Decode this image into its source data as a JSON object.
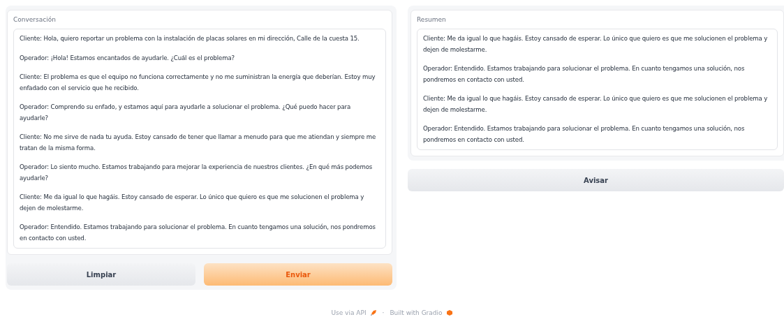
{
  "conversation": {
    "label": "Conversación",
    "messages": [
      "Cliente: Hola, quiero reportar un problema con la instalación de placas solares en mi dirección, Calle de la cuesta 15.",
      "Operador: ¡Hola! Estamos encantados de ayudarle. ¿Cuál es el problema?",
      "Cliente: El problema es que el equipo no funciona correctamente y no me suministran la energía que deberían. Estoy muy enfadado con el servicio que he recibido.",
      "Operador: Comprendo su enfado, y estamos aquí para ayudarle a solucionar el problema. ¿Qué puedo hacer para ayudarle?",
      "Cliente: No me sirve de nada tu ayuda. Estoy cansado de tener que llamar a menudo para que me atiendan y siempre me tratan de la misma forma.",
      "Operador: Lo siento mucho. Estamos trabajando para mejorar la experiencia de nuestros clientes. ¿En qué más podemos ayudarle?",
      "Cliente: Me da igual lo que hagáis. Estoy cansado de esperar. Lo único que quiero es que me solucionen el problema y dejen de molestarme.",
      "Operador: Entendido. Estamos trabajando para solucionar el problema. En cuanto tengamos una solución, nos pondremos en contacto con usted."
    ]
  },
  "buttons": [
    {
      "label": "Limpiar",
      "kind": "secondary"
    },
    {
      "label": "Enviar",
      "kind": "primary"
    }
  ],
  "summary": {
    "label": "Resumen",
    "messages": [
      "Cliente: Me da igual lo que hagáis. Estoy cansado de esperar. Lo único que quiero es que me solucionen el problema y dejen de molestarme.",
      "Operador: Entendido. Estamos trabajando para solucionar el problema. En cuanto tengamos una solución, nos pondremos en contacto con usted.",
      "Cliente: Me da igual lo que hagáis. Estoy cansado de esperar. Lo único que quiero es que me solucionen el problema y dejen de molestarme.",
      "Operador: Entendido. Estamos trabajando para solucionar el problema. En cuanto tengamos una solución, nos pondremos en contacto con usted."
    ]
  },
  "summary_button": {
    "label": "Avisar"
  },
  "footer": {
    "links": [
      "Use via API",
      "Built with Gradio"
    ],
    "separator": "·"
  }
}
